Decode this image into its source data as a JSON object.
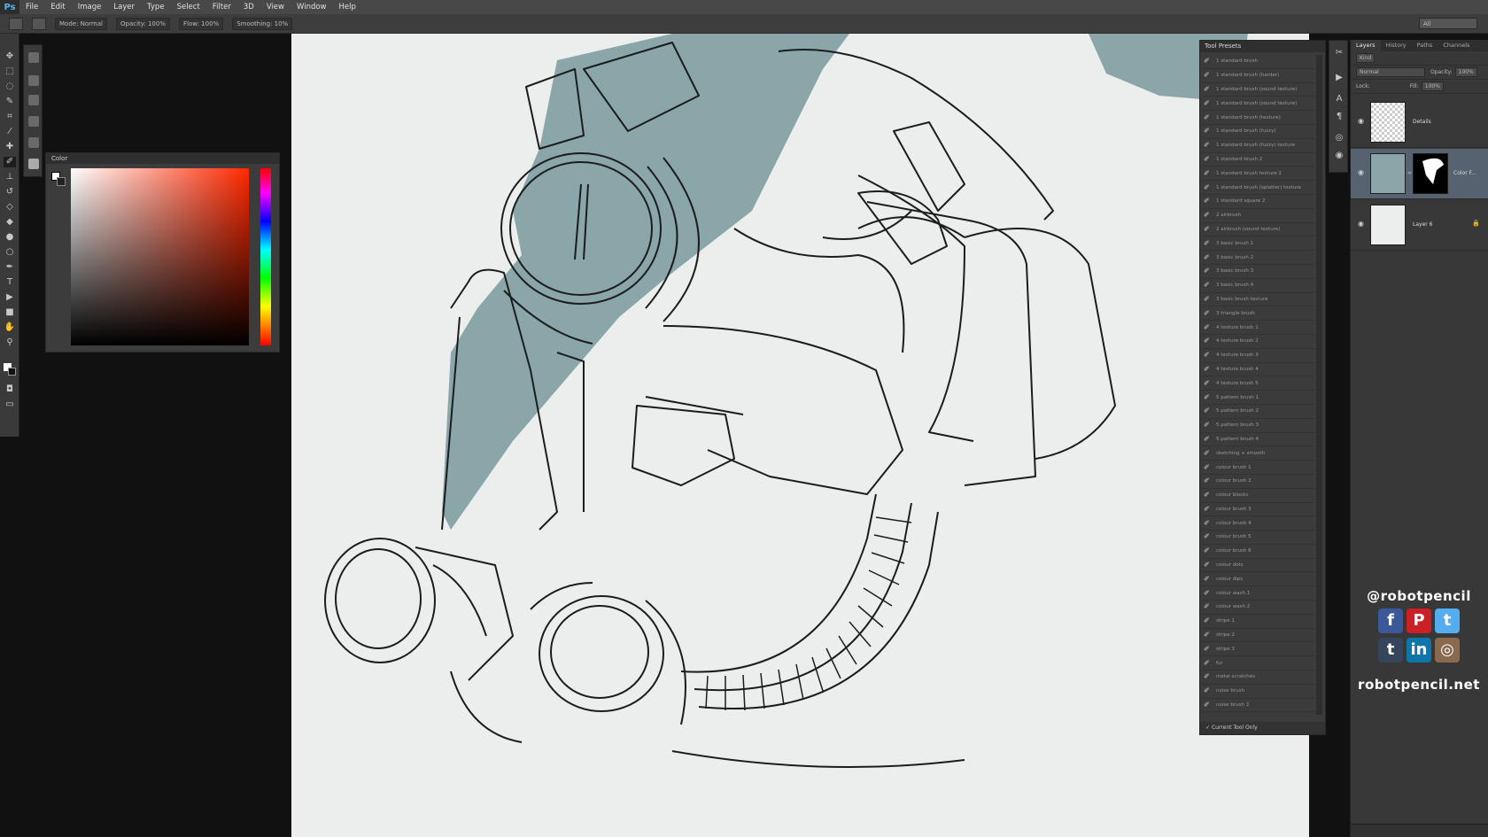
{
  "app": {
    "logo": "Ps"
  },
  "menu": [
    "File",
    "Edit",
    "Image",
    "Layer",
    "Type",
    "Select",
    "Filter",
    "3D",
    "View",
    "Window",
    "Help"
  ],
  "options_bar": {
    "mode": "Mode: Normal",
    "opacity": "Opacity: 100%",
    "flow": "Flow: 100%",
    "smoothing": "Smoothing: 10%",
    "workspace": "All"
  },
  "color_panel": {
    "title": "Color",
    "fg_color": "#ffffff",
    "bg_color": "#222222",
    "hue_color": "#ff2800"
  },
  "tool_presets": {
    "title": "Tool Presets",
    "footer": "Current Tool Only",
    "items": [
      "1 standard brush",
      "1 standard brush (harder)",
      "1 standard brush (sound texture)",
      "1 standard brush (sound texture)",
      "1 standard brush (texture)",
      "1 standard brush (fuzzy)",
      "1 standard brush (fuzzy) texture",
      "1 standard brush 2",
      "1 standard brush texture 2",
      "1 standard brush (splatter) texture",
      "1 standard square 2",
      "2 airbrush",
      "2 airbrush (sound texture)",
      "3 basic brush 1",
      "3 basic brush 2",
      "3 basic brush 3",
      "3 basic brush 4",
      "3 basic brush texture",
      "3 triangle brush",
      "4 texture brush 1",
      "4 texture brush 2",
      "4 texture brush 3",
      "4 texture brush 4",
      "4 texture brush 5",
      "5 pattern brush 1",
      "5 pattern brush 2",
      "5 pattern brush 3",
      "5 pattern brush 4",
      "sketching + smooth",
      "colour brush 1",
      "colour brush 2",
      "colour blocks",
      "colour brush 3",
      "colour brush 4",
      "colour brush 5",
      "colour brush 6",
      "colour dots",
      "colour dips",
      "colour wash 1",
      "colour wash 2",
      "stripe 1",
      "stripe 2",
      "stripe 3",
      "fur",
      "metal scratches",
      "noise brush",
      "noise brush 2",
      "rock"
    ]
  },
  "layers_panel": {
    "tabs": [
      "Layers",
      "History",
      "Paths",
      "Channels"
    ],
    "kind": "Kind",
    "blend_mode": "Normal",
    "opacity_label": "Opacity:",
    "opacity_value": "100%",
    "lock_label": "Lock:",
    "fill_label": "Fill:",
    "fill_value": "100%",
    "layers": [
      {
        "name": "Details"
      },
      {
        "name": "Color F..."
      },
      {
        "name": "Layer 6"
      }
    ]
  },
  "social": {
    "handle": "@robotpencil",
    "website": "robotpencil.net",
    "icons": [
      {
        "icon": "facebook-icon",
        "glyph": "f",
        "color": "#3b5998"
      },
      {
        "icon": "pinterest-icon",
        "glyph": "P",
        "color": "#cb2027"
      },
      {
        "icon": "twitter-icon",
        "glyph": "t",
        "color": "#55acee"
      },
      {
        "icon": "tumblr-icon",
        "glyph": "t",
        "color": "#35465c"
      },
      {
        "icon": "linkedin-icon",
        "glyph": "in",
        "color": "#0e76a8"
      },
      {
        "icon": "instagram-icon",
        "glyph": "◎",
        "color": "#8a6a4f"
      }
    ]
  },
  "colors": {
    "teal_fill": "#8aa6a8",
    "canvas_bg": "#eceeed",
    "line": "#1c1c1c"
  }
}
